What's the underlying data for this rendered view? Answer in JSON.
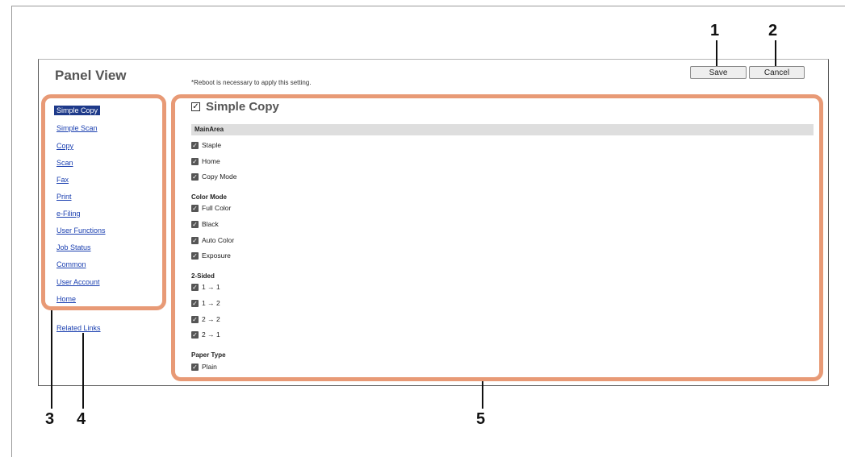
{
  "panel": {
    "title": "Panel View",
    "reboot_note": "*Reboot is necessary to apply this setting."
  },
  "toolbar": {
    "save_label": "Save",
    "cancel_label": "Cancel"
  },
  "callouts": [
    "1",
    "2",
    "3",
    "4",
    "5"
  ],
  "colors": {
    "highlight": "#e89a76",
    "active_nav": "#1e3a8a",
    "link": "#1a3fb0"
  },
  "sidebar": {
    "items": [
      {
        "label": "Simple Copy",
        "active": true
      },
      {
        "label": "Simple Scan"
      },
      {
        "label": "Copy"
      },
      {
        "label": "Scan"
      },
      {
        "label": "Fax"
      },
      {
        "label": "Print"
      },
      {
        "label": "e-Filing"
      },
      {
        "label": "User Functions"
      },
      {
        "label": "Job Status"
      },
      {
        "label": "Common"
      },
      {
        "label": "User Account"
      },
      {
        "label": "Home"
      }
    ],
    "related_links": "Related Links"
  },
  "main": {
    "title": "Simple Copy",
    "title_checked": true,
    "section": "MainArea",
    "main_items": [
      "Staple",
      "Home",
      "Copy Mode"
    ],
    "groups": [
      {
        "label": "Color Mode",
        "items": [
          "Full Color",
          "Black",
          "Auto Color",
          "Exposure"
        ]
      },
      {
        "label": "2-Sided",
        "items": [
          "1 → 1",
          "1 → 2",
          "2 → 2",
          "2 → 1"
        ]
      },
      {
        "label": "Paper Type",
        "items": [
          "Plain"
        ]
      }
    ]
  }
}
